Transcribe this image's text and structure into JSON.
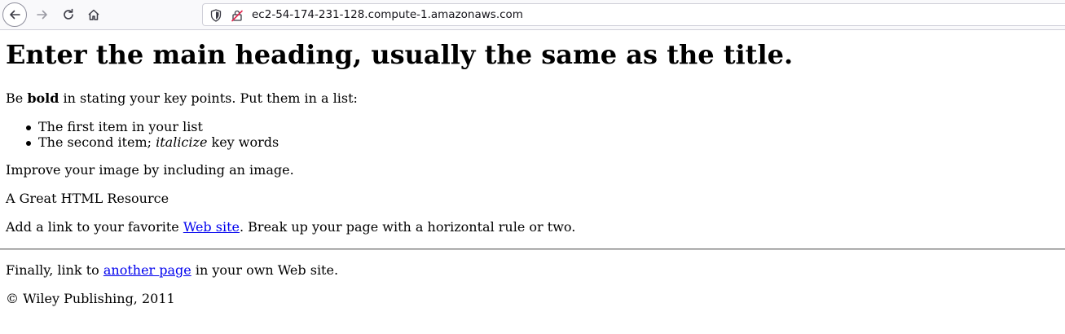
{
  "browser": {
    "url": "ec2-54-174-231-128.compute-1.amazonaws.com"
  },
  "page": {
    "heading": "Enter the main heading, usually the same as the title.",
    "p1_before": "Be ",
    "p1_bold": "bold",
    "p1_after": " in stating your key points. Put them in a list:",
    "list_item_1": "The first item in your list",
    "list_item_2_before": "The second item; ",
    "list_item_2_italic": "italicize",
    "list_item_2_after": " key words",
    "p2": "Improve your image by including an image.",
    "p3": "A Great HTML Resource",
    "p4_before": "Add a link to your favorite ",
    "p4_link": "Web site",
    "p4_after": ". Break up your page with a horizontal rule or two.",
    "p5_before": "Finally, link to ",
    "p5_link": "another page",
    "p5_after": " in your own Web site.",
    "footer": "© Wiley Publishing, 2011"
  },
  "colors": {
    "link": "#0000ee",
    "toolbar_bg": "#f9f9fb"
  }
}
